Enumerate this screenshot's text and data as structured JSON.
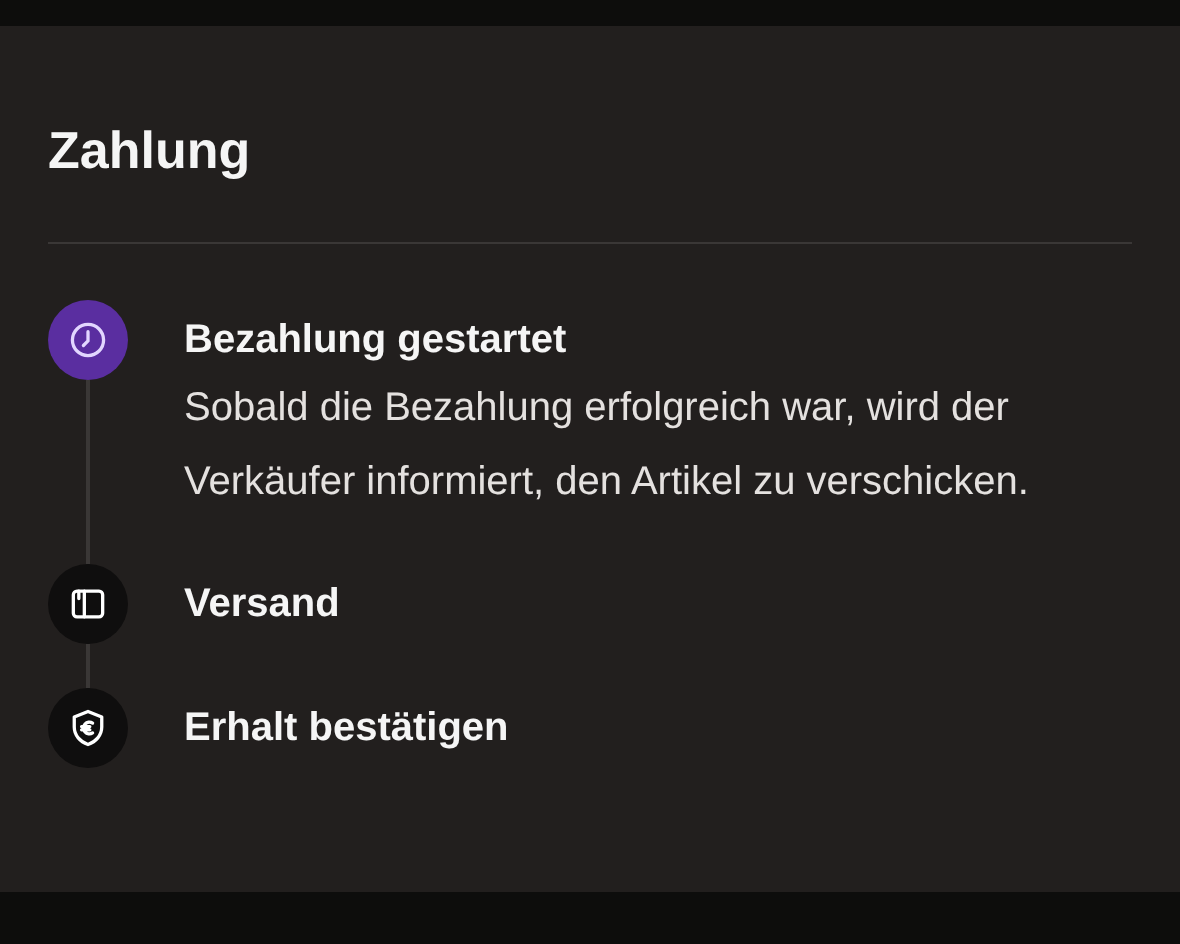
{
  "title": "Zahlung",
  "steps": [
    {
      "kind": "clock",
      "active": true,
      "title": "Bezahlung gestartet",
      "description": "Sobald die Bezahlung erfolgreich war, wird der Verkäufer informiert, den Artikel zu verschicken."
    },
    {
      "kind": "package",
      "active": false,
      "title": "Versand"
    },
    {
      "kind": "shield-euro",
      "active": false,
      "title": "Erhalt bestätigen"
    }
  ]
}
